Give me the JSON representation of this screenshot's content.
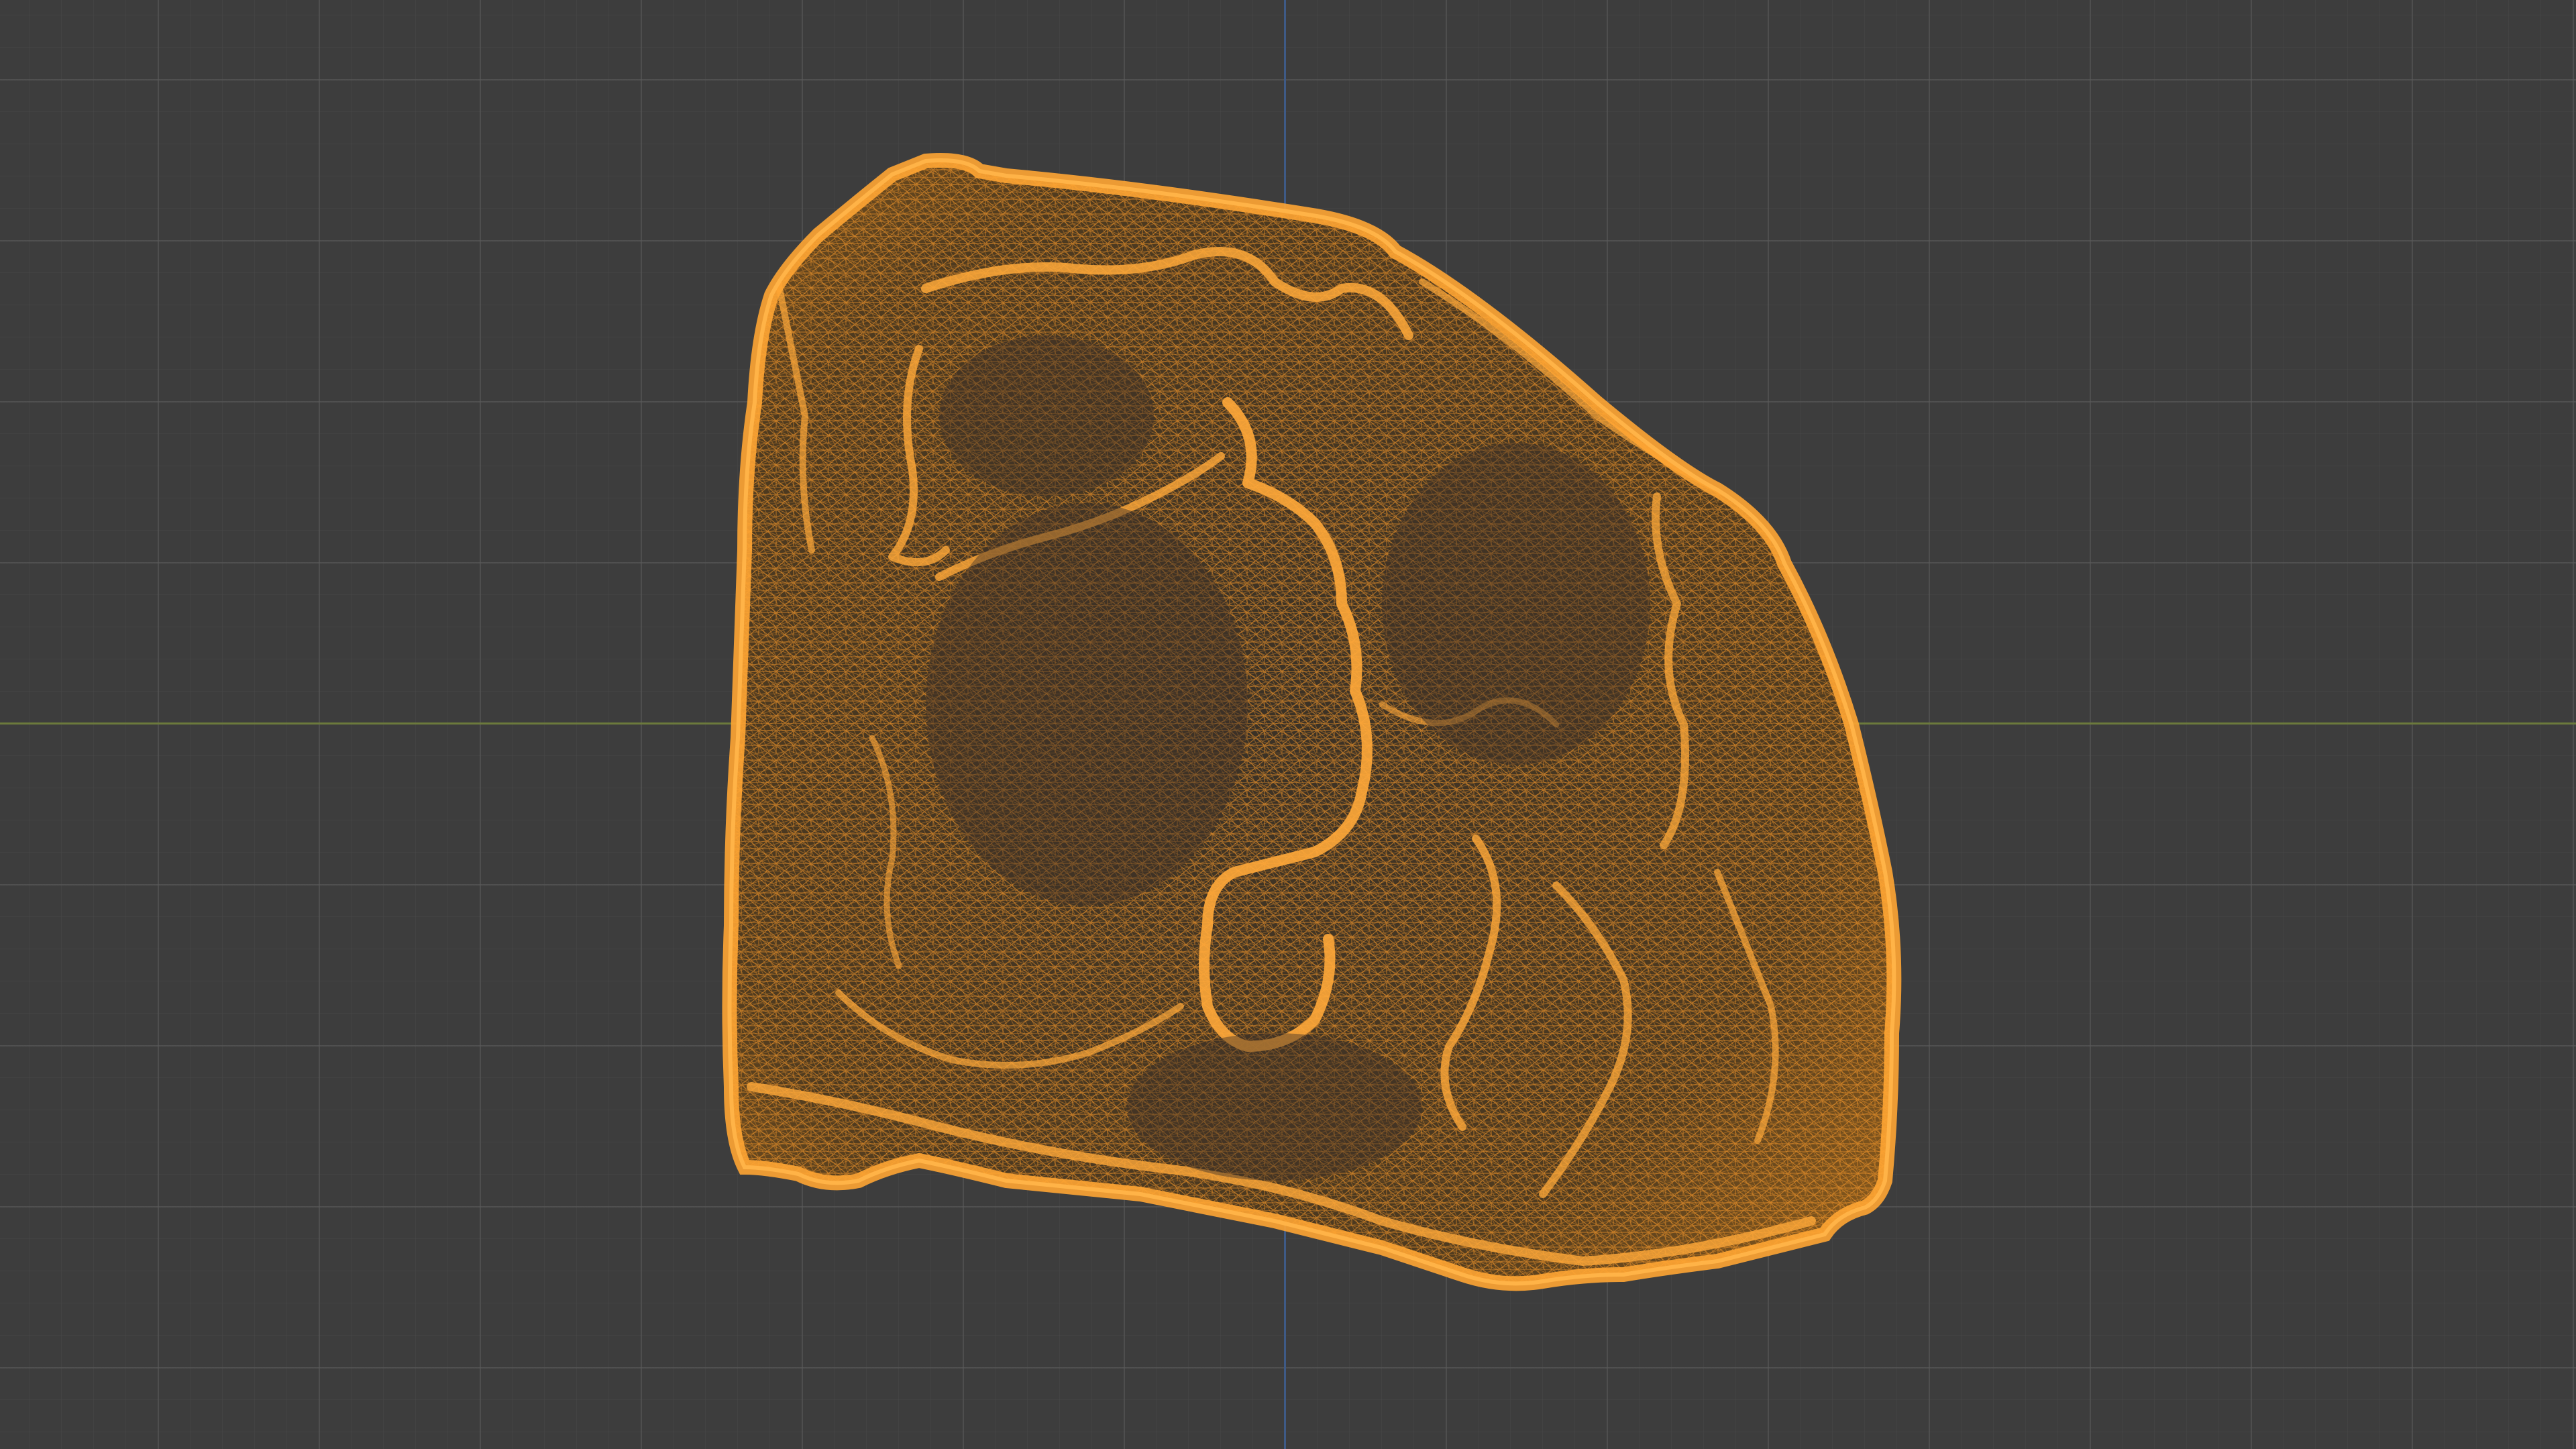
{
  "viewport": {
    "mode": "wireframe",
    "background_color": "#3d3d3d",
    "grid_color": "#4a4a4a",
    "x_axis_color": "#6c7a3c",
    "y_axis_color": "#3e5a86"
  },
  "object": {
    "icon": "rock-mesh-icon",
    "wire_color": "#f5962a",
    "fill_color": "#4a3a24",
    "selected": true
  }
}
